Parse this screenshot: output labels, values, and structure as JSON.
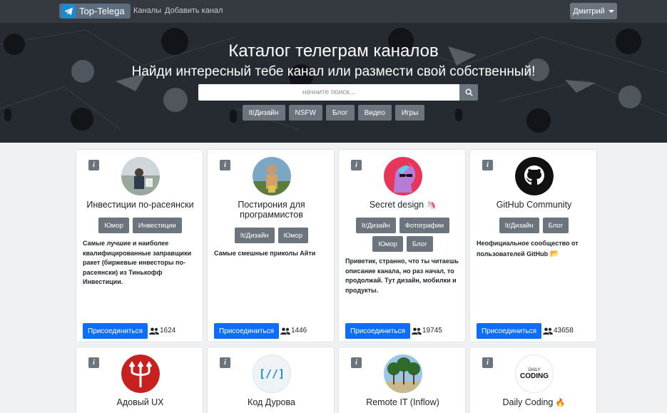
{
  "navbar": {
    "brand": "Top-Telega",
    "links": [
      "Каналы",
      "Добавить канал"
    ],
    "user": "Дмитрий"
  },
  "hero": {
    "title": "Каталог телеграм каналов",
    "subtitle": "Найди интересный тебе канал или размести свой собственный!",
    "search_placeholder": "начните поиск...",
    "categories": [
      "It/Дизайн",
      "NSFW",
      "Блог",
      "Видео",
      "Игры"
    ]
  },
  "colors": {
    "navbar": "#343a40",
    "hero": "#262a31",
    "tag": "#6c757d",
    "primary": "#0d6efd"
  },
  "cards": [
    {
      "info": "i",
      "title": "Инвестиции по-расеянски",
      "tags": [
        "Юмор",
        "Инвестиции"
      ],
      "description": "Самые лучшие и наиболее квалифицированные заправщики ракет (биржевые инвесторы по-расеянски) из Тинькофф Инвестиции.",
      "join": "Присоединиться",
      "members": "1624",
      "avatar_icon": "person-photo-icon"
    },
    {
      "info": "i",
      "title": "Постирония для программистов",
      "tags": [
        "It/Дизайн",
        "Юмор"
      ],
      "description": "Самые смешные приколы Айти",
      "join": "Присоединиться",
      "members": "1446",
      "avatar_icon": "meme-photo-icon"
    },
    {
      "info": "i",
      "title": "Secret design",
      "title_emoji": "🦄",
      "tags": [
        "It/Дизайн",
        "Фотографии",
        "Юмор",
        "Блог"
      ],
      "description": "Приветик, странно, что ты читаешь описание канала, но раз начал, то продолжай. Тут дизайн, мобилки и продукты.",
      "join": "Присоединиться",
      "members": "19745",
      "avatar_icon": "unicorn-icon"
    },
    {
      "info": "i",
      "title": "GitHub Community",
      "tags": [
        "It/Дизайн",
        "Блог"
      ],
      "description": "Неофициальное сообщество от пользователей GitHub",
      "description_emoji": "📂",
      "join": "Присоединиться",
      "members": "43658",
      "avatar_icon": "github-icon"
    },
    {
      "info": "i",
      "title": "Адовый UX",
      "avatar_icon": "trident-icon"
    },
    {
      "info": "i",
      "title": "Код Дурова",
      "avatar_text": "[//]",
      "avatar_icon": "code-brackets-icon"
    },
    {
      "info": "i",
      "title": "Remote IT (Inflow)",
      "avatar_icon": "palm-trees-icon"
    },
    {
      "info": "i",
      "title": "Daily Coding",
      "title_emoji": "🔥",
      "avatar_small": "DAILY",
      "avatar_big": "CODING",
      "avatar_icon": "daily-coding-logo-icon"
    }
  ]
}
